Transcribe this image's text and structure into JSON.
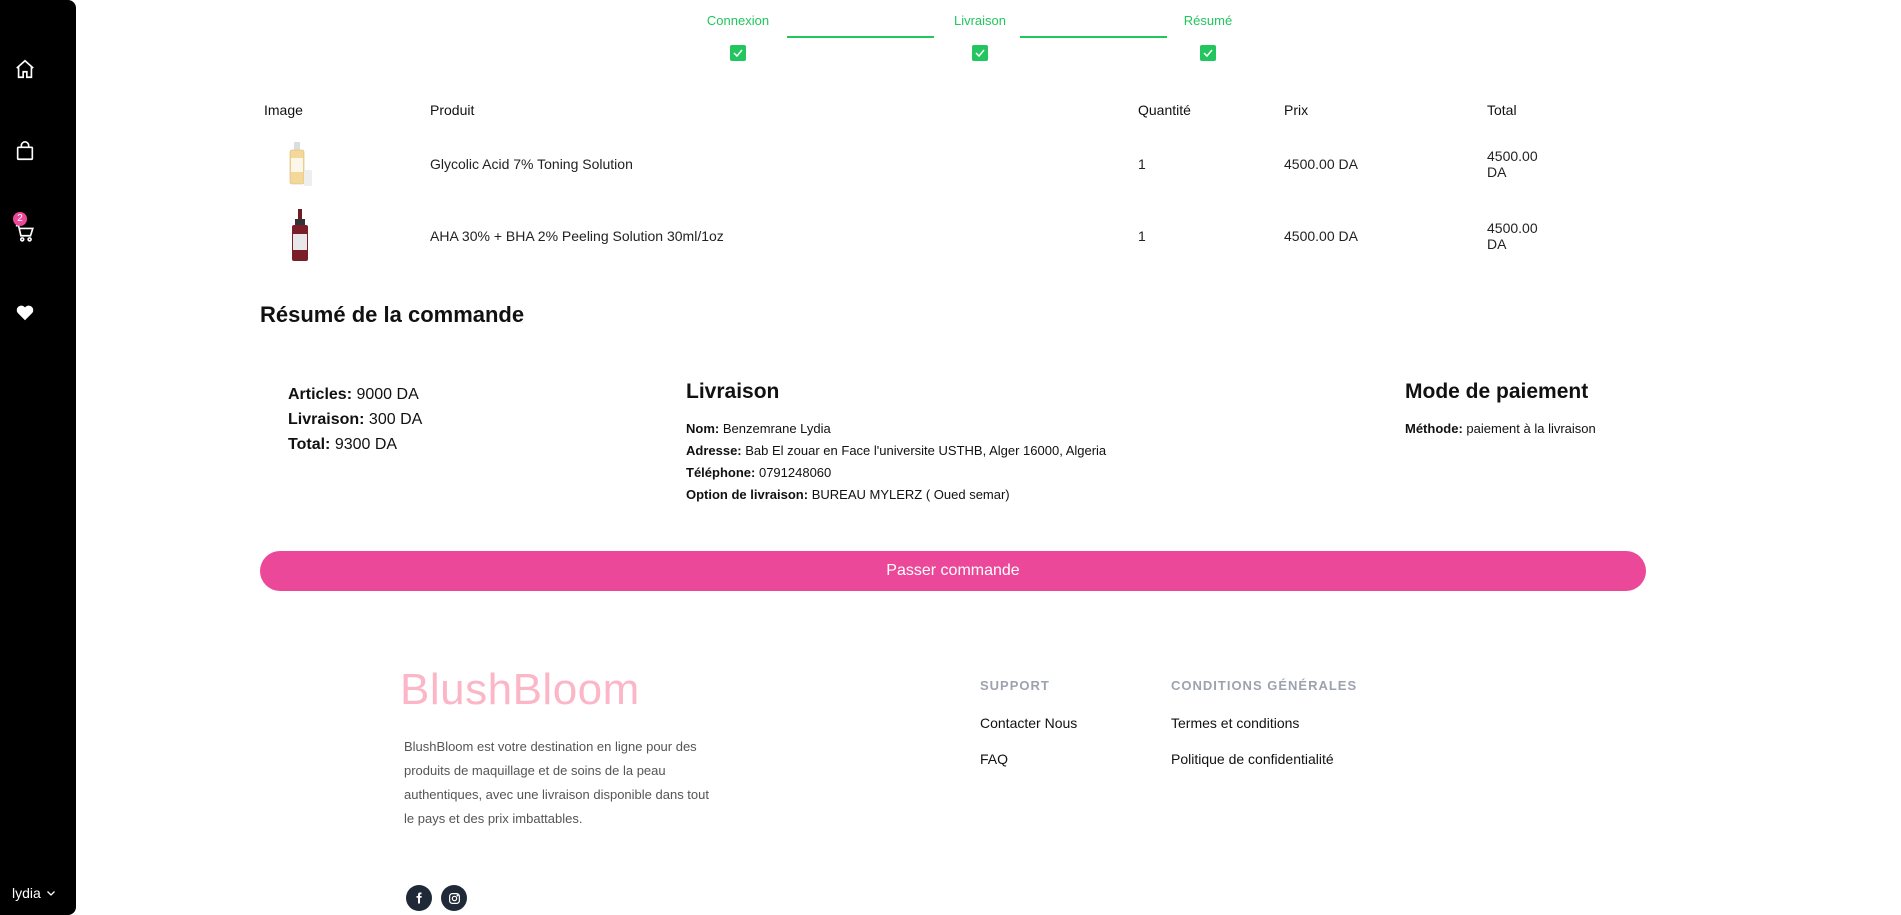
{
  "sidebar": {
    "icons": [
      "home-icon",
      "shopping-bag-icon",
      "cart-icon",
      "heart-icon"
    ],
    "cart_count": "2",
    "user_name": "lydia"
  },
  "stepper": {
    "steps": [
      {
        "label": "Connexion",
        "done": true
      },
      {
        "label": "Livraison",
        "done": true
      },
      {
        "label": "Résumé",
        "done": true
      }
    ],
    "accent": "#22c55e"
  },
  "table": {
    "headers": [
      "Image",
      "Produit",
      "Quantité",
      "Prix",
      "Total"
    ],
    "rows": [
      {
        "image": "serum-bottle-amber",
        "product": "Glycolic Acid 7% Toning Solution",
        "qty": "1",
        "price": "4500.00 DA",
        "total": "4500.00 DA"
      },
      {
        "image": "dropper-bottle-red",
        "product": "AHA 30% + BHA 2% Peeling Solution 30ml/1oz",
        "qty": "1",
        "price": "4500.00 DA",
        "total": "4500.00 DA"
      }
    ]
  },
  "summary": {
    "title": "Résumé de la commande",
    "articles_label": "Articles:",
    "articles_value": "9000 DA",
    "shipping_label": "Livraison:",
    "shipping_value": "300 DA",
    "total_label": "Total:",
    "total_value": "9300 DA"
  },
  "delivery": {
    "title": "Livraison",
    "name_label": "Nom:",
    "name_value": "Benzemrane Lydia",
    "address_label": "Adresse:",
    "address_value": "Bab El zouar en Face l'universite USTHB, Alger 16000, Algeria",
    "phone_label": "Téléphone:",
    "phone_value": "0791248060",
    "option_label": "Option de livraison:",
    "option_value": "BUREAU MYLERZ ( Oued semar)"
  },
  "payment": {
    "title": "Mode de paiement",
    "method_label": "Méthode:",
    "method_value": "paiement à la livraison"
  },
  "order_button": "Passer commande",
  "footer": {
    "brand": "BlushBloom",
    "description": "BlushBloom est votre destination en ligne pour des produits de maquillage et de soins de la peau authentiques, avec une livraison disponible dans tout le pays et des prix imbattables.",
    "support": {
      "head": "SUPPORT",
      "links": [
        "Contacter Nous",
        "FAQ"
      ]
    },
    "conditions": {
      "head": "CONDITIONS GÉNÉRALES",
      "links": [
        "Termes et conditions",
        "Politique de confidentialité"
      ]
    },
    "social": [
      "facebook-icon",
      "instagram-icon"
    ]
  },
  "colors": {
    "brand_pink": "#ec4899",
    "brand_light_pink": "#fbb6c7",
    "sidebar": "#000000"
  }
}
